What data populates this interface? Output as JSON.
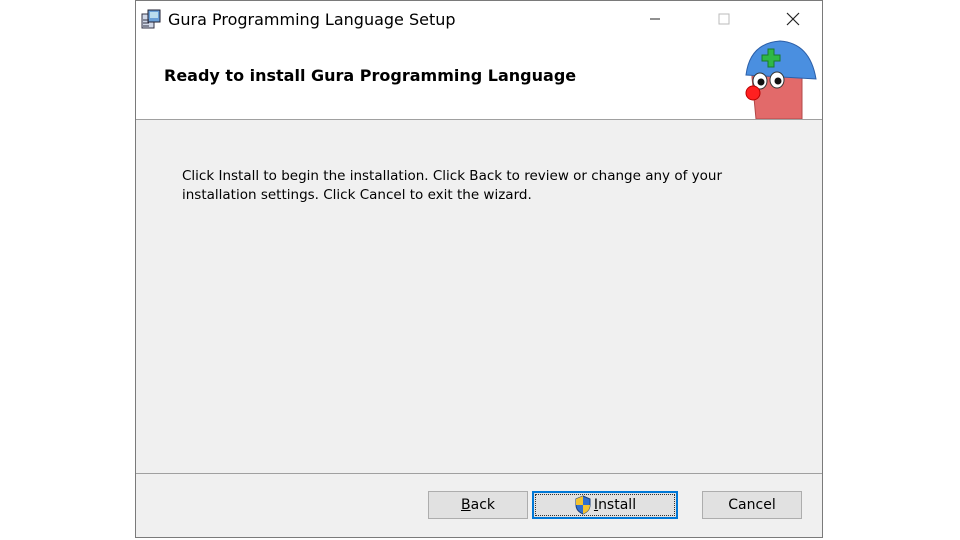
{
  "window": {
    "title": "Gura Programming Language Setup",
    "controls": {
      "minimize": "—",
      "maximize": "☐",
      "close": "✕"
    }
  },
  "header": {
    "title": "Ready to install Gura Programming Language",
    "mascot_icon": "helmet-mascot-icon"
  },
  "content": {
    "message": "Click Install to begin the installation. Click Back to review or change any of your installation settings. Click Cancel to exit the wizard."
  },
  "buttons": {
    "back": {
      "mnemonic": "B",
      "rest": "ack"
    },
    "install": {
      "mnemonic": "I",
      "rest": "nstall",
      "icon": "uac-shield-icon"
    },
    "cancel": "Cancel"
  },
  "colors": {
    "accent_focus": "#0078d7",
    "dialog_background": "#f0f0f0"
  }
}
